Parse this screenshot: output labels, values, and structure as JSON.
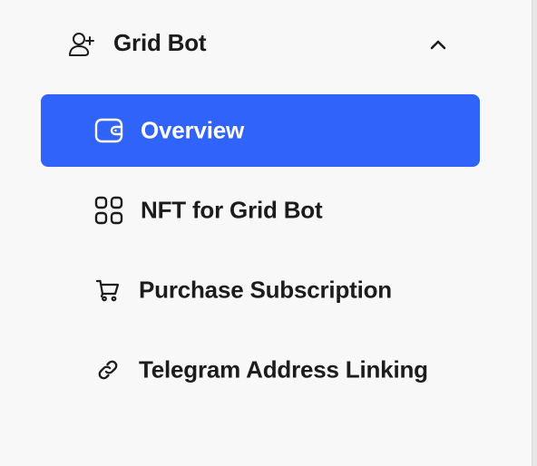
{
  "section": {
    "title": "Grid Bot",
    "icon": "user-plus-icon",
    "expanded": true
  },
  "menu": {
    "items": [
      {
        "label": "Overview",
        "icon": "wallet-icon",
        "active": true
      },
      {
        "label": "NFT for Grid Bot",
        "icon": "grid-icon",
        "active": false
      },
      {
        "label": "Purchase Subscription",
        "icon": "cart-icon",
        "active": false
      },
      {
        "label": "Telegram Address Linking",
        "icon": "link-icon",
        "active": false
      }
    ]
  },
  "colors": {
    "active_bg": "#2f63fa",
    "text": "#1c1c1c",
    "background": "#f8f8f8"
  }
}
